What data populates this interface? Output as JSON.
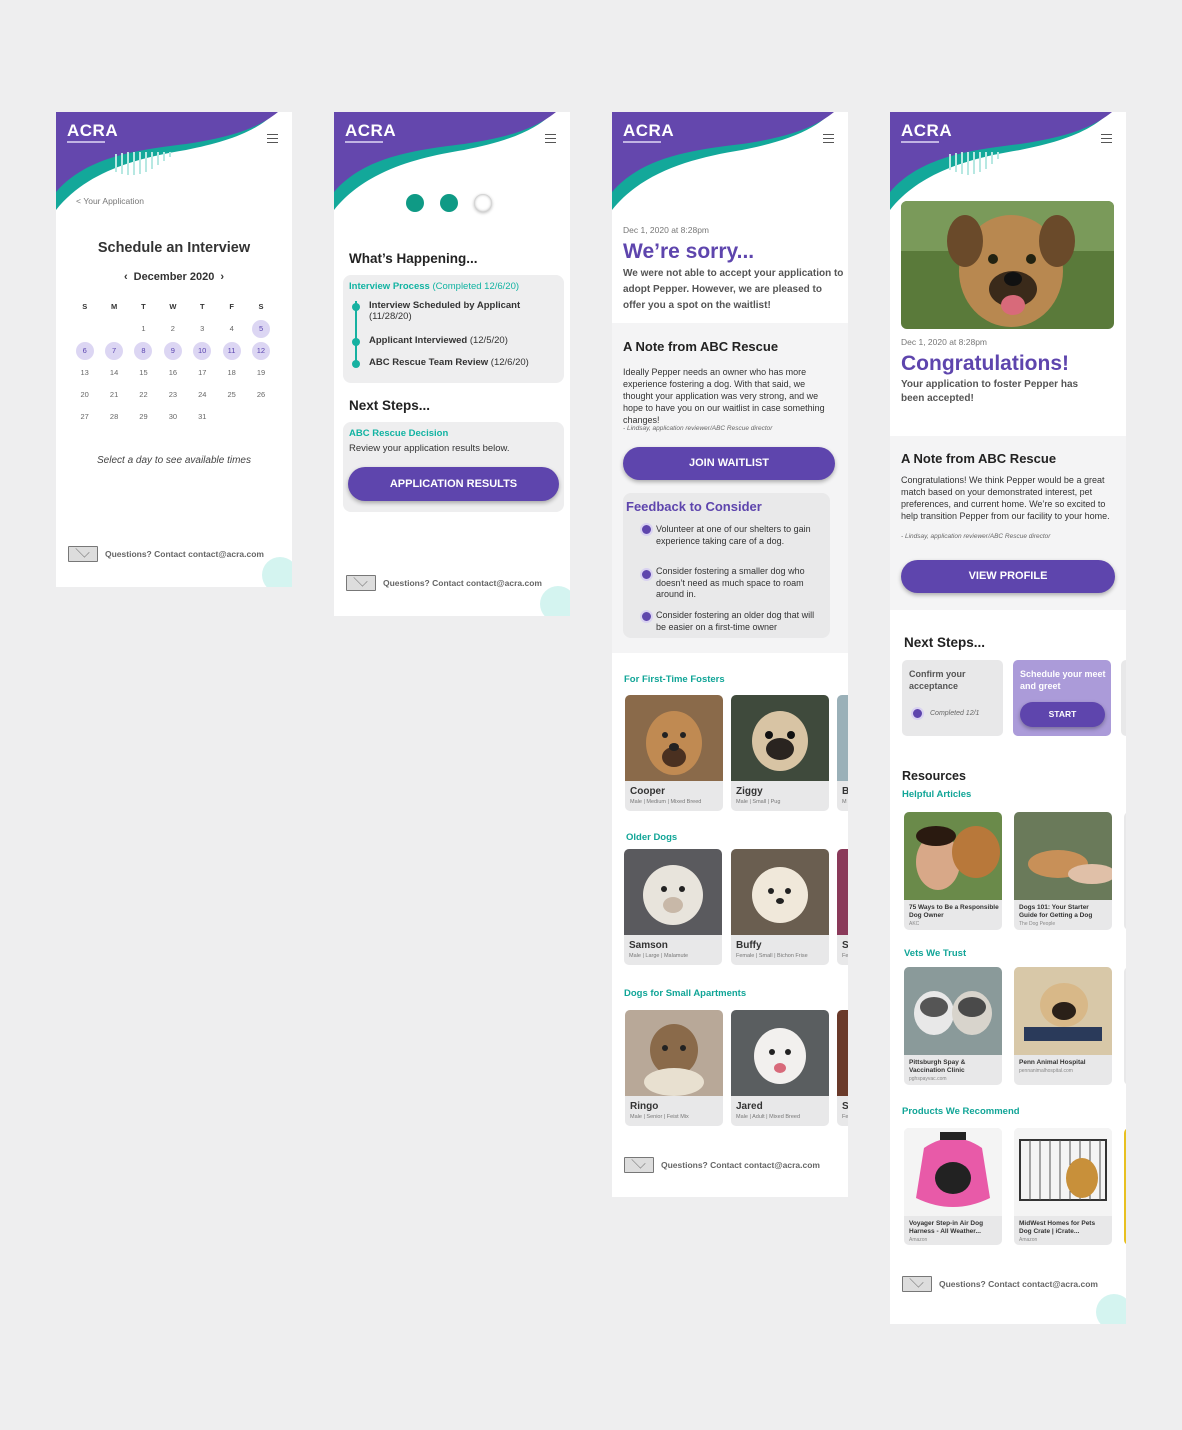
{
  "brand": {
    "logo": "ACRA",
    "accent": "#5e45ad",
    "teal": "#11b3a2"
  },
  "footer": {
    "text": "Questions? Contact contact@acra.com"
  },
  "icons": {
    "menu": "hamburger-icon",
    "mail": "envelope-icon",
    "check": "check-icon",
    "back": "chevron-left-icon"
  },
  "s1": {
    "back": "Your Application",
    "title": "Schedule an Interview",
    "month": "December 2020",
    "weekdays": [
      "S",
      "M",
      "T",
      "W",
      "T",
      "F",
      "S"
    ],
    "hint": "Select a day to see available times"
  },
  "s2": {
    "whats_happening": "What’s Happening...",
    "process_label": "Interview Process",
    "process_status": "(Completed 12/6/20)",
    "steps": [
      {
        "label": "Interview Scheduled by Applicant",
        "date": "(11/28/20)"
      },
      {
        "label": "Applicant Interviewed",
        "date": "(12/5/20)"
      },
      {
        "label": "ABC Rescue Team Review",
        "date": "(12/6/20)"
      }
    ],
    "next_steps": "Next Steps...",
    "decision_title": "ABC Rescue Decision",
    "decision_text": "Review your application results below.",
    "results_button": "APPLICATION RESULTS"
  },
  "s3": {
    "date": "Dec 1, 2020 at 8:28pm",
    "title": "We’re sorry...",
    "subtitle": "We were not able to accept your application to adopt Pepper. However, we are pleased to offer you a spot on the waitlist!",
    "note_title": "A Note from ABC Rescue",
    "note_text": "Ideally Pepper needs an owner who has more experience fostering a dog. With that said, we thought your application was very strong, and we hope to have you on our waitlist in case something changes!",
    "note_sig": "- Lindsay, application reviewer/ABC Rescue director",
    "waitlist_button": "JOIN WAITLIST",
    "feedback_title": "Feedback to Consider",
    "feedback": [
      "Volunteer at one of our shelters to gain experience taking care of a dog.",
      "Consider fostering a smaller dog who doesn’t need as much space to roam around in.",
      "Consider fostering an older dog that will be easier on a first-time owner"
    ],
    "sections": [
      {
        "title": "For First-Time Fosters",
        "dogs": [
          {
            "name": "Cooper",
            "desc": "Male | Medium | Mixed Breed"
          },
          {
            "name": "Ziggy",
            "desc": "Male | Small | Pug"
          },
          {
            "name": "B",
            "desc": "M"
          }
        ]
      },
      {
        "title": "Older Dogs",
        "dogs": [
          {
            "name": "Samson",
            "desc": "Male | Large | Malamute"
          },
          {
            "name": "Buffy",
            "desc": "Female | Small | Bichon Frise"
          },
          {
            "name": "S",
            "desc": "Fe"
          }
        ]
      },
      {
        "title": "Dogs for Small Apartments",
        "dogs": [
          {
            "name": "Ringo",
            "desc": "Male | Senior | Feist Mix"
          },
          {
            "name": "Jared",
            "desc": "Male | Adult | Mixed Breed"
          },
          {
            "name": "S",
            "desc": "Fe"
          }
        ]
      }
    ]
  },
  "s4": {
    "date": "Dec 1, 2020 at 8:28pm",
    "title": "Congratulations!",
    "subtitle": "Your application to foster Pepper has been accepted!",
    "note_title": "A Note from ABC Rescue",
    "note_text": "Congratulations! We think Pepper would be a great match based on your demonstrated interest, pet preferences, and current home. We’re so excited to help transition Pepper from our facility to your home.",
    "note_sig": "- Lindsay, application reviewer/ABC Rescue director",
    "profile_button": "VIEW PROFILE",
    "next_steps": "Next Steps...",
    "step1_title": "Confirm your acceptance",
    "step1_status": "Completed 12/1",
    "step2_title": "Schedule your meet and greet",
    "step2_button": "START",
    "resources": "Resources",
    "articles_title": "Helpful Articles",
    "articles": [
      {
        "name": "75 Ways to Be a Responsible Dog Owner",
        "src": "AKC"
      },
      {
        "name": "Dogs 101: Your Starter Guide for Getting a Dog",
        "src": "The Dog People"
      }
    ],
    "vets_title": "Vets We Trust",
    "vets": [
      {
        "name": "Pittsburgh Spay & Vaccination Clinic",
        "src": "pghspayvac.com"
      },
      {
        "name": "Penn Animal Hospital",
        "src": "pennanimalhospital.com"
      }
    ],
    "products_title": "Products We Recommend",
    "products": [
      {
        "name": "Voyager Step-in Air Dog Harness - All Weather...",
        "src": "Amazon"
      },
      {
        "name": "MidWest Homes for Pets Dog Crate | iCrate...",
        "src": "Amazon"
      }
    ]
  }
}
